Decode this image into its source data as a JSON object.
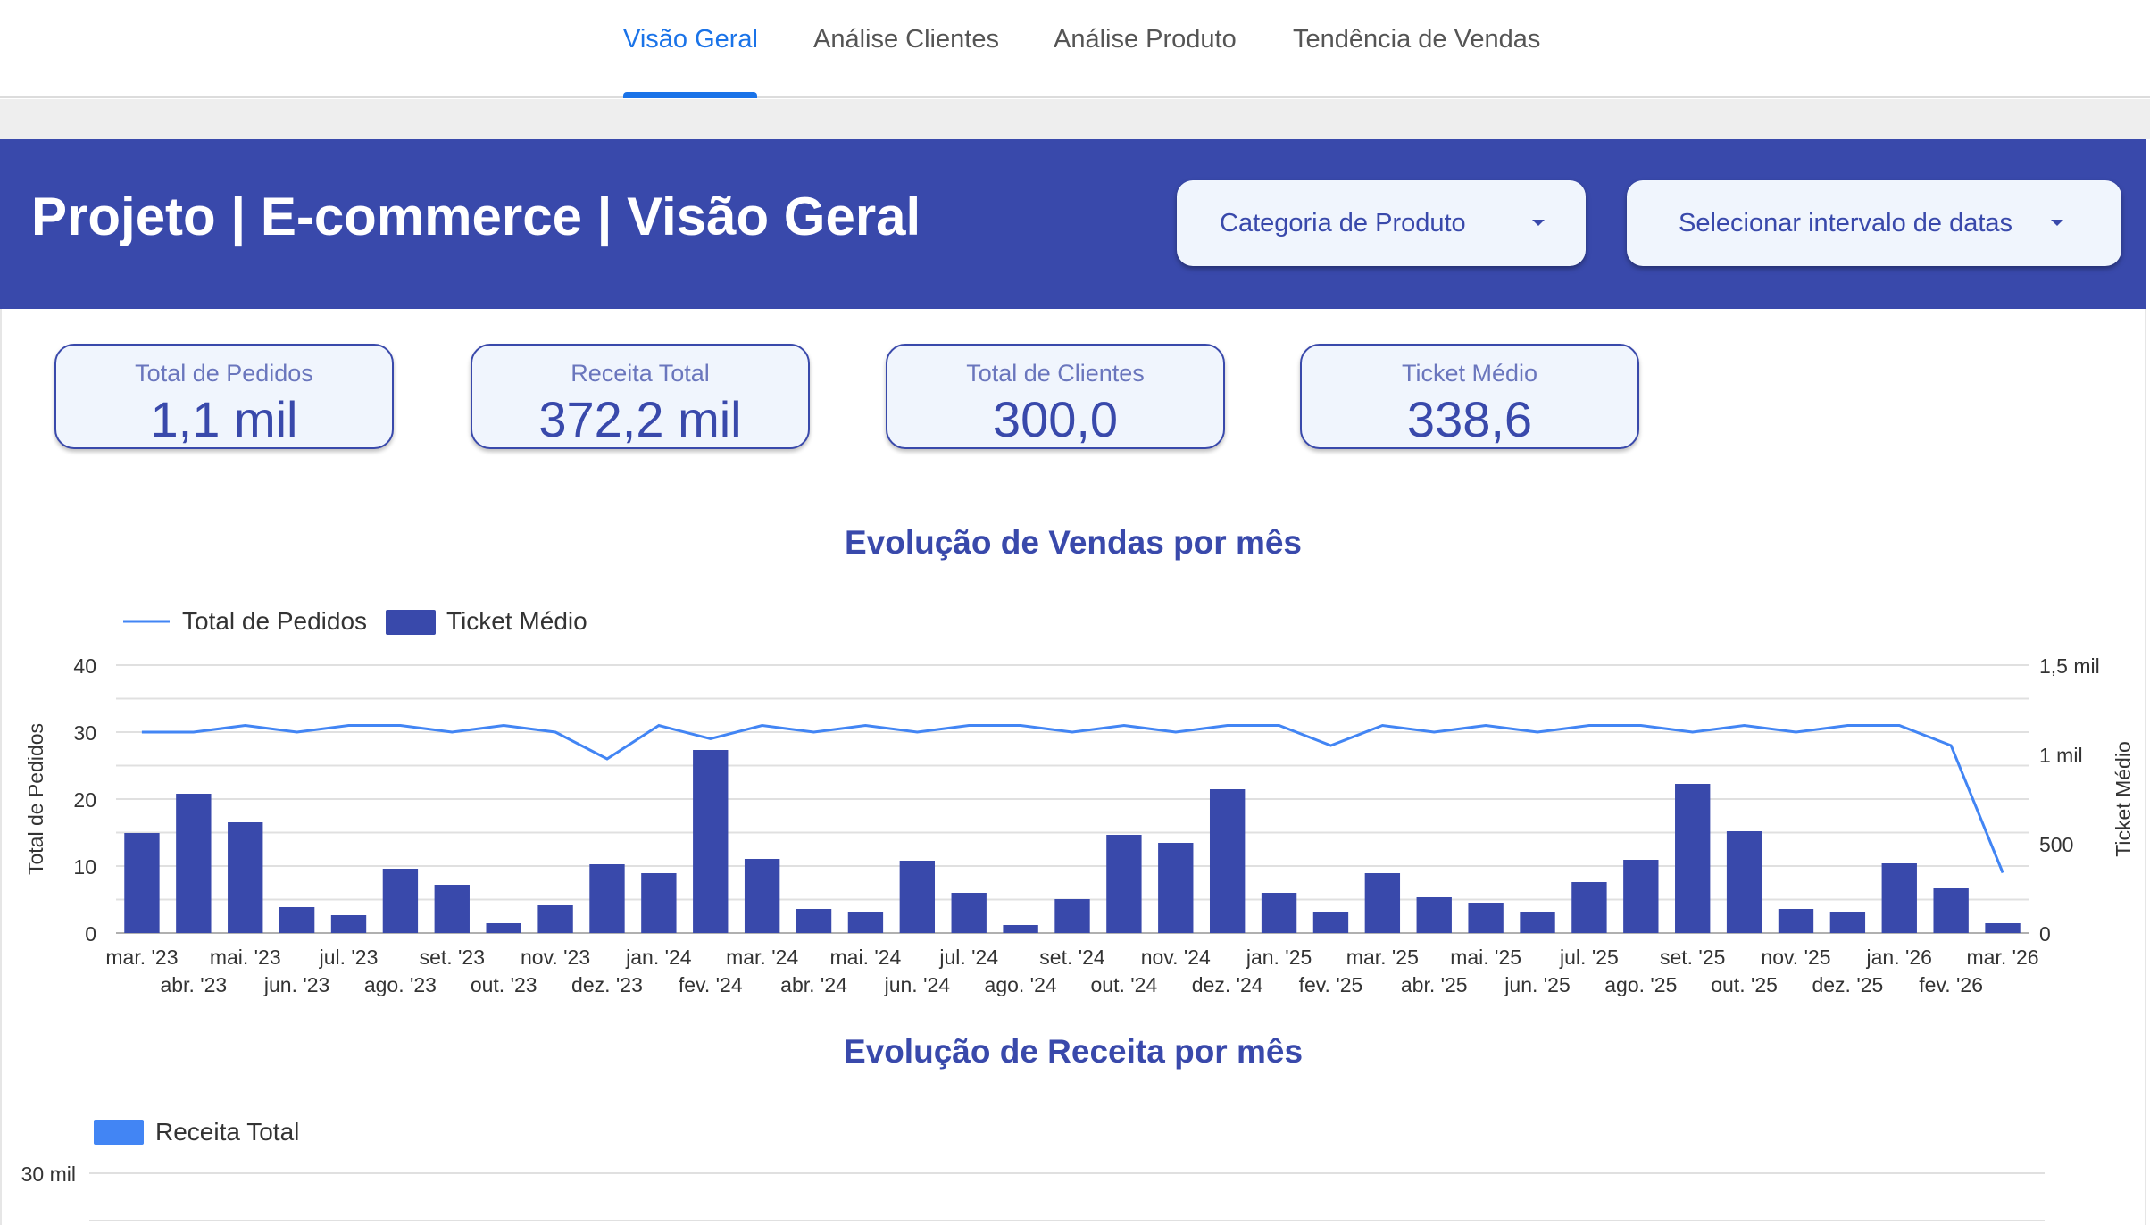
{
  "nav": {
    "tabs": [
      {
        "label": "Visão Geral",
        "active": true
      },
      {
        "label": "Análise Clientes",
        "active": false
      },
      {
        "label": "Análise Produto",
        "active": false
      },
      {
        "label": "Tendência de Vendas",
        "active": false
      }
    ]
  },
  "header": {
    "title": "Projeto | E-commerce | Visão Geral",
    "filters": [
      {
        "label": "Categoria de Produto",
        "icon": "caret-down-icon"
      },
      {
        "label": "Selecionar intervalo de datas",
        "icon": "caret-down-icon"
      }
    ]
  },
  "kpis": [
    {
      "label": "Total de Pedidos",
      "value": "1,1 mil"
    },
    {
      "label": "Receita Total",
      "value": "372,2 mil"
    },
    {
      "label": "Total de Clientes",
      "value": "300,0"
    },
    {
      "label": "Ticket Médio",
      "value": "338,6"
    }
  ],
  "colors": {
    "brand": "#3949ab",
    "accent": "#1a73e8",
    "line": "#4285f4",
    "revenue_bar": "#4285f4",
    "card_bg": "#f0f5fd"
  },
  "chart_data": [
    {
      "type": "bar",
      "title": "Evolução de Vendas por mês",
      "legend_position": "top-left",
      "grid": true,
      "categories": [
        "mar. '23",
        "abr. '23",
        "mai. '23",
        "jun. '23",
        "jul. '23",
        "ago. '23",
        "set. '23",
        "out. '23",
        "nov. '23",
        "dez. '23",
        "jan. '24",
        "fev. '24",
        "mar. '24",
        "abr. '24",
        "mai. '24",
        "jun. '24",
        "jul. '24",
        "ago. '24",
        "set. '24",
        "out. '24",
        "nov. '24",
        "dez. '24",
        "jan. '25",
        "fev. '25",
        "mar. '25",
        "abr. '25",
        "mai. '25",
        "jun. '25",
        "jul. '25",
        "ago. '25",
        "set. '25",
        "out. '25",
        "nov. '25",
        "dez. '25",
        "jan. '26",
        "fev. '26",
        "mar. '26"
      ],
      "ylabel": "Total de Pedidos",
      "y2label": "Ticket Médio",
      "ylim": [
        0,
        40
      ],
      "y2lim": [
        0,
        1500
      ],
      "yticks": [
        0,
        10,
        20,
        30,
        40
      ],
      "ytick_labels": [
        "0",
        "10",
        "20",
        "30",
        "40"
      ],
      "y2ticks": [
        0,
        500,
        1000,
        1500
      ],
      "y2tick_labels": [
        "0",
        "500",
        "1 mil",
        "1,5 mil"
      ],
      "series": [
        {
          "name": "Total de Pedidos",
          "kind": "line",
          "axis": "left",
          "values": [
            30,
            30,
            31,
            30,
            31,
            31,
            30,
            31,
            30,
            26,
            31,
            29,
            31,
            30,
            31,
            30,
            31,
            31,
            30,
            31,
            30,
            31,
            31,
            28,
            31,
            30,
            31,
            30,
            31,
            31,
            30,
            31,
            30,
            31,
            31,
            28,
            9
          ]
        },
        {
          "name": "Ticket Médio",
          "kind": "bar",
          "axis": "right",
          "values": [
            560,
            780,
            620,
            145,
            100,
            360,
            270,
            55,
            155,
            385,
            335,
            1025,
            415,
            135,
            115,
            405,
            225,
            45,
            190,
            550,
            505,
            805,
            225,
            120,
            335,
            200,
            170,
            115,
            285,
            410,
            835,
            570,
            135,
            115,
            390,
            250,
            55
          ]
        }
      ]
    },
    {
      "type": "bar",
      "title": "Evolução de Receita por mês",
      "legend_position": "top-left",
      "grid": true,
      "ytick_top_label": "30 mil",
      "series": [
        {
          "name": "Receita Total"
        }
      ]
    }
  ]
}
